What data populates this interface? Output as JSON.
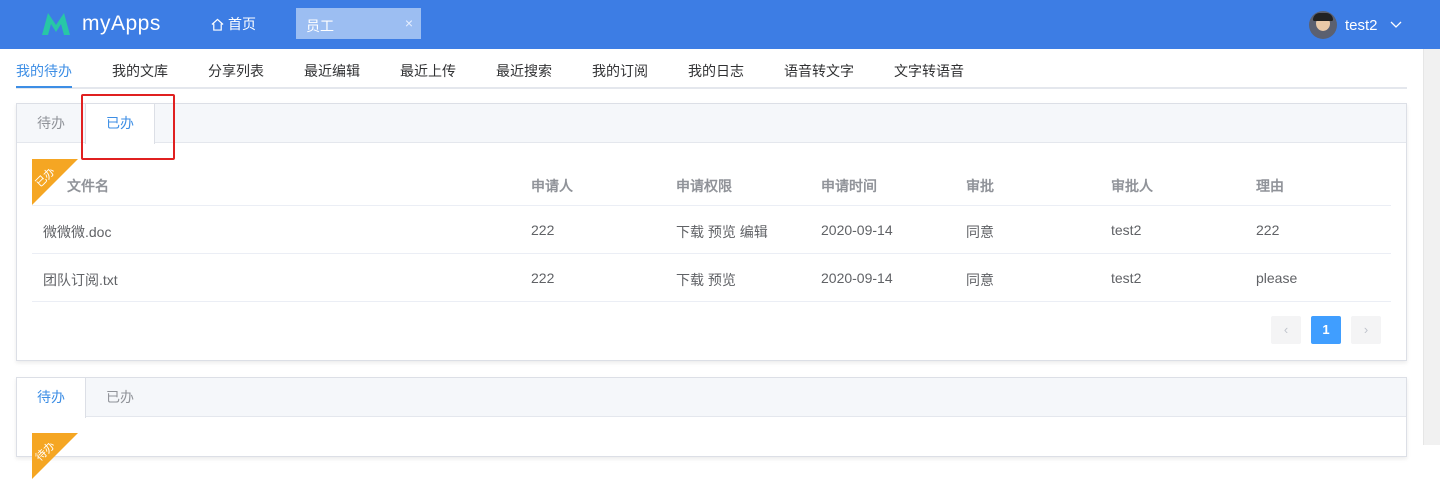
{
  "app": {
    "name": "myApps",
    "logo_icon": "m-logo-icon",
    "accent": "#3d7de4"
  },
  "header": {
    "home_label": "首页",
    "open_tab": {
      "label": "员工",
      "close": "×"
    },
    "user": {
      "name": "test2"
    }
  },
  "nav": {
    "items": [
      {
        "label": "我的待办",
        "active": true
      },
      {
        "label": "我的文库"
      },
      {
        "label": "分享列表"
      },
      {
        "label": "最近编辑"
      },
      {
        "label": "最近上传"
      },
      {
        "label": "最近搜索"
      },
      {
        "label": "我的订阅"
      },
      {
        "label": "我的日志"
      },
      {
        "label": "语音转文字"
      },
      {
        "label": "文字转语音"
      }
    ]
  },
  "panel1": {
    "tabs": [
      {
        "label": "待办"
      },
      {
        "label": "已办",
        "active": true
      }
    ],
    "ribbon": "已办",
    "columns": [
      "文件名",
      "申请人",
      "申请权限",
      "申请时间",
      "审批",
      "审批人",
      "理由"
    ],
    "rows": [
      [
        "微微微.doc",
        "222",
        "下载 预览 编辑",
        "2020-09-14",
        "同意",
        "test2",
        "222"
      ],
      [
        "团队订阅.txt",
        "222",
        "下载 预览",
        "2020-09-14",
        "同意",
        "test2",
        "please"
      ]
    ],
    "pagination": {
      "prev": "‹",
      "current": "1",
      "next": "›"
    }
  },
  "panel2": {
    "tabs": [
      {
        "label": "待办",
        "active": true
      },
      {
        "label": "已办"
      }
    ],
    "ribbon": "待办"
  }
}
